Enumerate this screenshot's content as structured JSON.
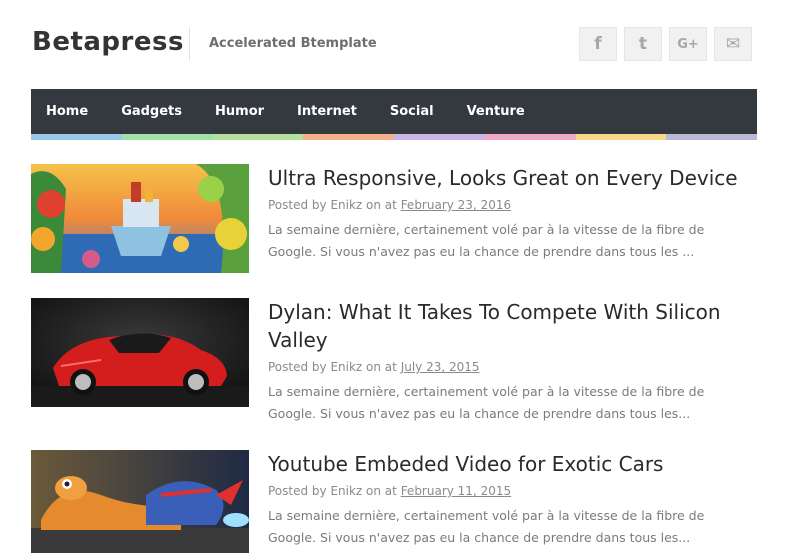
{
  "site": {
    "title": "Betapress",
    "tagline": "Accelerated Btemplate"
  },
  "social": [
    {
      "icon": "facebook-icon",
      "glyph": "f"
    },
    {
      "icon": "tumblr-icon",
      "glyph": "t"
    },
    {
      "icon": "google-plus-icon",
      "glyph": "G+"
    },
    {
      "icon": "email-icon",
      "glyph": "✉"
    }
  ],
  "nav": {
    "items": [
      "Home",
      "Gadgets",
      "Humor",
      "Internet",
      "Social",
      "Venture"
    ],
    "stripe_colors": [
      "#9ac8e8",
      "#a3dfa8",
      "#b4e0a0",
      "#f4b08a",
      "#c9b6e6",
      "#f0a8c8",
      "#f6d98a",
      "#b9b9d9"
    ]
  },
  "posts": [
    {
      "title": "Ultra Responsive, Looks Great on Every Device",
      "meta_prefix": "Posted by Enikz on at ",
      "date": "February 23, 2016",
      "excerpt": "La semaine dernière, certainement volé par à la vitesse de la fibre de Google. Si vous n'avez pas eu la chance de prendre dans tous les ...",
      "image": "cartoon-boat-image"
    },
    {
      "title": "Dylan: What It Takes To Compete With Silicon Valley",
      "meta_prefix": "Posted by Enikz on at ",
      "date": "July 23, 2015",
      "excerpt": "La semaine dernière, certainement volé par à la vitesse de la fibre de Google. Si vous n'avez pas eu la chance de prendre dans tous les...",
      "image": "red-sports-car-image"
    },
    {
      "title": "Youtube Embeded Video for Exotic Cars",
      "meta_prefix": "Posted by Enikz on at ",
      "date": "February 11, 2015",
      "excerpt": "La semaine dernière, certainement volé par à la vitesse de la fibre de Google. Si vous n'avez pas eu la chance de prendre dans tous les...",
      "image": "racing-snail-image"
    }
  ]
}
